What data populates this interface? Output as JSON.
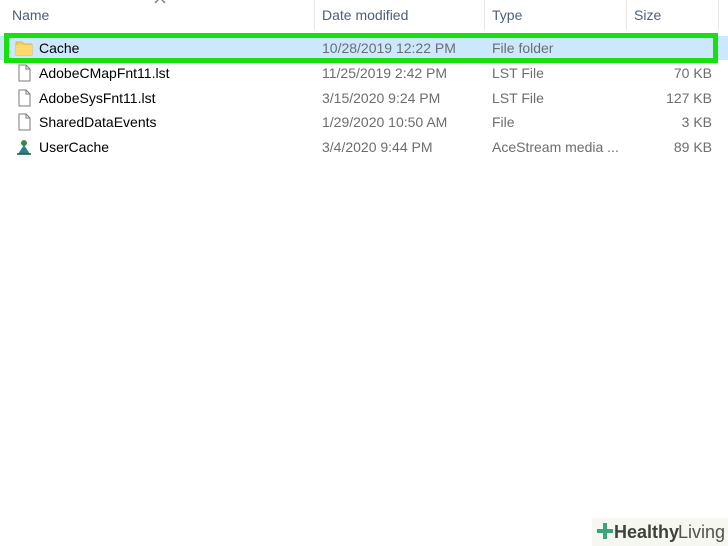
{
  "columns": {
    "name": "Name",
    "date_modified": "Date modified",
    "type": "Type",
    "size": "Size"
  },
  "files": [
    {
      "name": "Cache",
      "date": "10/28/2019 12:22 PM",
      "type": "File folder",
      "size": "",
      "icon": "folder-icon",
      "selected": true
    },
    {
      "name": "AdobeCMapFnt11.lst",
      "date": "11/25/2019 2:42 PM",
      "type": "LST File",
      "size": "70 KB",
      "icon": "document-icon"
    },
    {
      "name": "AdobeSysFnt11.lst",
      "date": "3/15/2020 9:24 PM",
      "type": "LST File",
      "size": "127 KB",
      "icon": "document-icon"
    },
    {
      "name": "SharedDataEvents",
      "date": "1/29/2020 10:50 AM",
      "type": "File",
      "size": "3 KB",
      "icon": "document-icon"
    },
    {
      "name": "UserCache",
      "date": "3/4/2020 9:44 PM",
      "type": "AceStream media ...",
      "size": "89 KB",
      "icon": "acestream-icon"
    }
  ],
  "watermark": {
    "brand_bold": "Healthy",
    "brand_light": "Living"
  },
  "colors": {
    "selection": "#cce8ff",
    "highlight_box": "#18e00f",
    "header_text": "#4c607a"
  }
}
